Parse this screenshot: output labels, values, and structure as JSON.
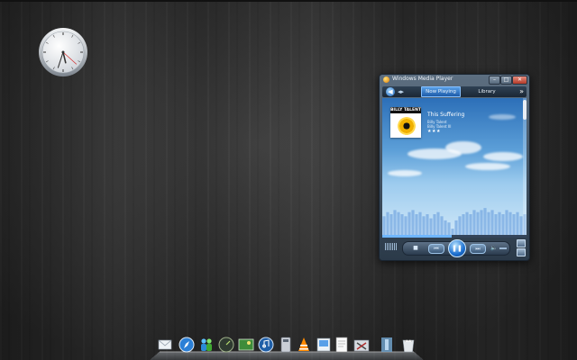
{
  "desktop": {
    "clock_gadget": {
      "hour": 5,
      "minute": 33,
      "second": 22
    }
  },
  "wmp": {
    "title": "Windows Media Player",
    "window_controls": {
      "minimize": "–",
      "maximize": "□",
      "close": "✕"
    },
    "nav": {
      "back_glyph": "◀",
      "tabs": [
        {
          "label": "Now Playing",
          "active": true
        },
        {
          "label": "Library",
          "active": false
        }
      ],
      "more_glyph": "»"
    },
    "now_playing": {
      "album_art_text": "BILLY TALENT II",
      "song_title": "This Suffering",
      "artist": "Billy Talent",
      "album": "Billy Talent III",
      "rating": "★★★"
    },
    "progress": 0.48,
    "visualizer_levels": [
      0.45,
      0.55,
      0.5,
      0.6,
      0.55,
      0.5,
      0.45,
      0.55,
      0.6,
      0.5,
      0.55,
      0.45,
      0.5,
      0.4,
      0.5,
      0.55,
      0.45,
      0.35,
      0.3,
      0.15,
      0.35,
      0.45,
      0.5,
      0.55,
      0.5,
      0.6,
      0.55,
      0.6,
      0.65,
      0.55,
      0.6,
      0.5,
      0.55,
      0.5,
      0.6,
      0.55,
      0.5,
      0.55,
      0.45,
      0.5
    ],
    "controls": {
      "stop": "■",
      "prev": "⏮",
      "play_pause": "❚❚",
      "next": "⏭",
      "volume": "🔈"
    },
    "colors": {
      "accent": "#1c6fd0",
      "sky_top": "#2c6fb8",
      "sky_bottom": "#cfe7f8"
    }
  },
  "dock": {
    "icons": [
      "mail-icon",
      "safari-icon",
      "messenger-icon",
      "dashboard-icon",
      "photos-icon",
      "itunes-icon",
      "finder-icon",
      "vlc-icon",
      "preview-icon",
      "textedit-icon",
      "utilities-icon",
      "trash-icon"
    ]
  }
}
